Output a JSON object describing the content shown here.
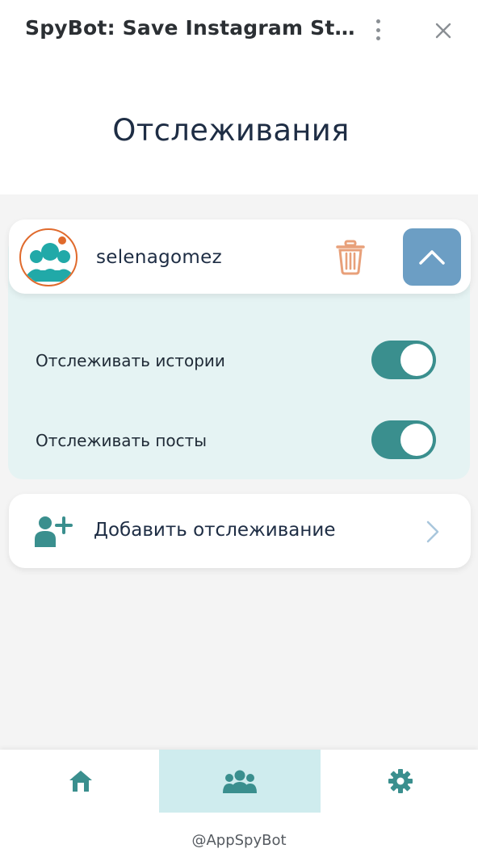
{
  "window": {
    "title": "SpyBot: Save Instagram Sto...",
    "menu_icon": "kebab-menu-icon",
    "close_icon": "close-icon"
  },
  "page": {
    "title": "Отслеживания"
  },
  "tracked": [
    {
      "username": "selenagomez",
      "avatar_icon": "group-avatar-icon",
      "delete_icon": "trash-icon",
      "collapse_icon": "chevron-up-icon",
      "options": [
        {
          "label": "Отслеживать истории",
          "enabled": true
        },
        {
          "label": "Отслеживать посты",
          "enabled": true
        }
      ]
    }
  ],
  "add_tracking": {
    "label": "Добавить отслеживание",
    "icon": "add-user-icon",
    "chevron_icon": "chevron-right-icon"
  },
  "bottom_nav": {
    "items": [
      {
        "name": "home",
        "icon": "home-icon",
        "active": false
      },
      {
        "name": "tracking",
        "icon": "users-icon",
        "active": true
      },
      {
        "name": "settings",
        "icon": "gear-icon",
        "active": false
      }
    ],
    "footer": "@AppSpyBot"
  },
  "colors": {
    "teal": "#3a8f8e",
    "accent_blue": "#6c9ec4",
    "trash": "#e8a07a",
    "avatar_ring": "#e06a2c",
    "active_nav_bg": "#cfecee",
    "panel_bg": "#e5f3f3"
  }
}
